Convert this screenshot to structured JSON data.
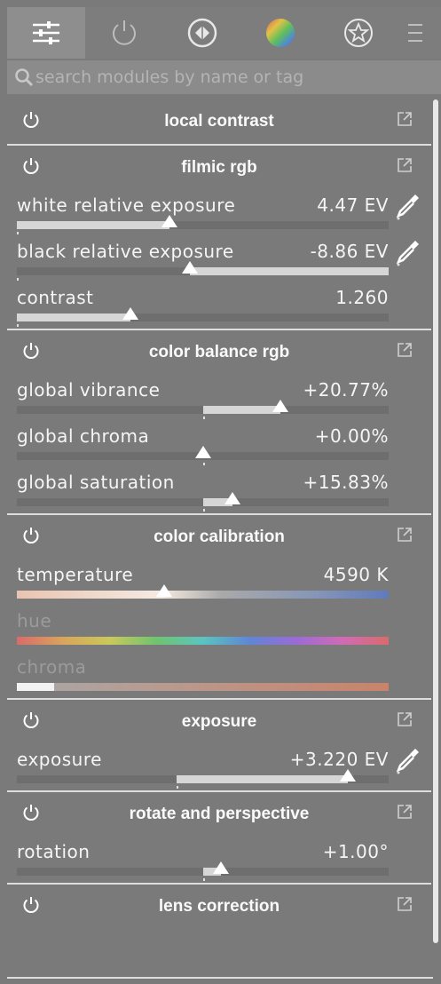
{
  "search": {
    "placeholder": "search modules by name or tag"
  },
  "tabs": [
    {
      "icon": "sliders-icon",
      "active": true
    },
    {
      "icon": "power-icon"
    },
    {
      "icon": "aperture-icon"
    },
    {
      "icon": "color-wheel-icon"
    },
    {
      "icon": "favorites-icon"
    },
    {
      "icon": "menu-icon"
    }
  ],
  "modules": [
    {
      "title": "local contrast",
      "sliders": []
    },
    {
      "title": "filmic rgb",
      "sliders": [
        {
          "label": "white relative exposure",
          "value": "4.47 EV",
          "level": 0.41,
          "picker": true
        },
        {
          "label": "black relative exposure",
          "value": "-8.86 EV",
          "level": 0.465,
          "picker": true,
          "fill_from_knob": true
        },
        {
          "label": "contrast",
          "value": "1.260",
          "level": 0.305
        }
      ]
    },
    {
      "title": "color balance rgb",
      "sliders": [
        {
          "label": "global vibrance",
          "value": "+20.77%",
          "level": 0.71,
          "center": 0.5
        },
        {
          "label": "global chroma",
          "value": "+0.00%",
          "level": 0.5,
          "center": 0.5
        },
        {
          "label": "global saturation",
          "value": "+15.83%",
          "level": 0.58,
          "center": 0.5
        }
      ]
    },
    {
      "title": "color calibration",
      "sliders": [
        {
          "label": "temperature",
          "value": "4590 K",
          "level": 0.395,
          "gradient": "temp"
        },
        {
          "label": "hue",
          "value": "",
          "level": 0,
          "gradient": "hue",
          "dim": true
        },
        {
          "label": "chroma",
          "value": "",
          "level": 0.1,
          "gradient": "chroma",
          "dim": true
        }
      ]
    },
    {
      "title": "exposure",
      "sliders": [
        {
          "label": "exposure",
          "value": "+3.220 EV",
          "level": 0.89,
          "center": 0.43,
          "picker": true
        }
      ]
    },
    {
      "title": "rotate and perspective",
      "sliders": [
        {
          "label": "rotation",
          "value": "+1.00°",
          "level": 0.55,
          "center": 0.5
        }
      ]
    },
    {
      "title": "lens correction",
      "sliders": []
    }
  ],
  "colors": {
    "background": "#7a7a7a",
    "fill": "#d6d6d6",
    "track": "#6e6e6e"
  }
}
